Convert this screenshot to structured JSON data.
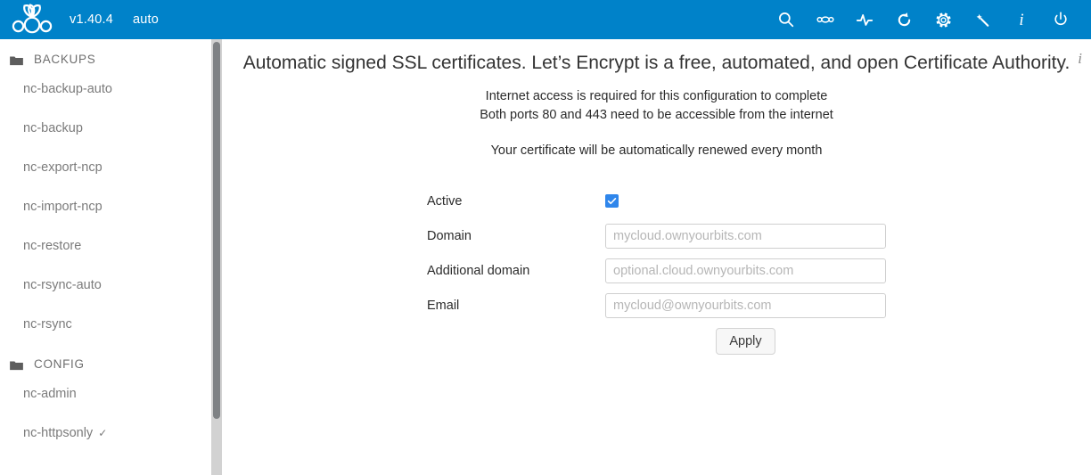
{
  "header": {
    "logo_icon": "nextcloudpi-raspberry-logo",
    "version": "v1.40.4",
    "mode": "auto",
    "background_color": "#0082c9",
    "toolbar": [
      {
        "name": "search-icon",
        "label": "search"
      },
      {
        "name": "link-icon",
        "label": "link"
      },
      {
        "name": "activity-pulse-icon",
        "label": "activity"
      },
      {
        "name": "update-refresh-icon",
        "label": "update"
      },
      {
        "name": "gear-icon",
        "label": "settings"
      },
      {
        "name": "magic-wand-icon",
        "label": "wizard"
      },
      {
        "name": "info-icon",
        "label": "info",
        "glyph": "i"
      },
      {
        "name": "power-icon",
        "label": "power"
      }
    ]
  },
  "sidebar": {
    "groups": [
      {
        "label": "BACKUPS",
        "icon": "folder-icon",
        "items": [
          {
            "label": "nc-backup-auto",
            "checked": false
          },
          {
            "label": "nc-backup",
            "checked": false
          },
          {
            "label": "nc-export-ncp",
            "checked": false
          },
          {
            "label": "nc-import-ncp",
            "checked": false
          },
          {
            "label": "nc-restore",
            "checked": false
          },
          {
            "label": "nc-rsync-auto",
            "checked": false
          },
          {
            "label": "nc-rsync",
            "checked": false
          }
        ]
      },
      {
        "label": "CONFIG",
        "icon": "folder-icon",
        "items": [
          {
            "label": "nc-admin",
            "checked": false
          },
          {
            "label": "nc-httpsonly",
            "checked": true,
            "check_mark": "✓"
          }
        ]
      }
    ],
    "scrollbar": {
      "track_color": "#d2d2d2",
      "thumb_color": "#7f8285"
    }
  },
  "main": {
    "heading": "Automatic signed SSL certificates. Let’s Encrypt is a free, automated, and open Certificate Authority.",
    "info_glyph": "i",
    "lead_lines": [
      "Internet access is required for this configuration to complete",
      "Both ports 80 and 443 need to be accessible from the internet",
      "Your certificate will be automatically renewed every month"
    ],
    "form": {
      "active": {
        "label": "Active",
        "checked": true,
        "accent_color": "#2f86eb"
      },
      "domain": {
        "label": "Domain",
        "value": "",
        "placeholder": "mycloud.ownyourbits.com"
      },
      "additional_domain": {
        "label": "Additional domain",
        "value": "",
        "placeholder": "optional.cloud.ownyourbits.com"
      },
      "email": {
        "label": "Email",
        "value": "",
        "placeholder": "mycloud@ownyourbits.com"
      },
      "apply_label": "Apply"
    }
  }
}
